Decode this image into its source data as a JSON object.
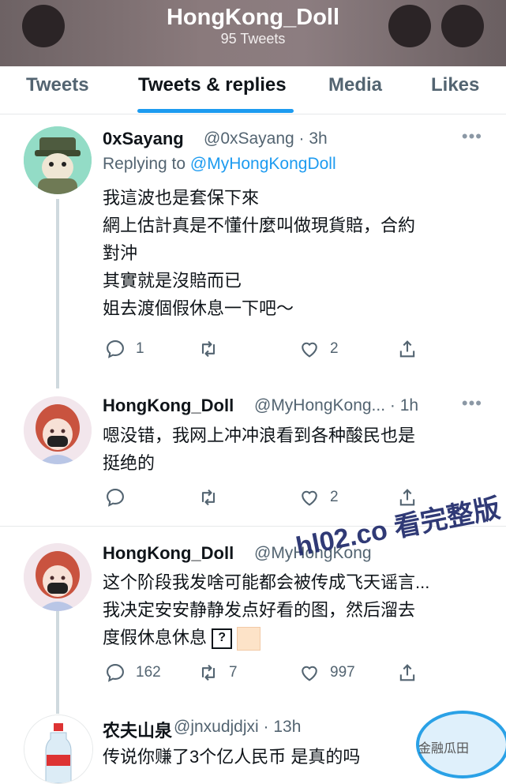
{
  "header": {
    "title": "HongKong_Doll",
    "subtitle": "95 Tweets"
  },
  "tabs": [
    {
      "label": "Tweets",
      "active": false
    },
    {
      "label": "Tweets & replies",
      "active": true
    },
    {
      "label": "Media",
      "active": false
    },
    {
      "label": "Likes",
      "active": false
    }
  ],
  "tweets": [
    {
      "name": "0xSayang",
      "meta": "@0xSayang · 3h",
      "reply_prefix": "Replying to",
      "reply_handle": "@MyHongKongDoll",
      "lines": [
        "我這波也是套保下來",
        "網上估計真是不懂什麼叫做現貨賠，合約",
        "對沖",
        "其實就是沒賠而已",
        "姐去渡個假休息一下吧～"
      ],
      "replies": "1",
      "retweets": "",
      "likes": "2"
    },
    {
      "name": "HongKong_Doll",
      "meta": "@MyHongKong... · 1h",
      "lines": [
        "嗯没错，我网上冲冲浪看到各种酸民也是",
        "挺绝的"
      ],
      "replies": "",
      "retweets": "",
      "likes": "2"
    },
    {
      "name": "HongKong_Doll",
      "meta": "@MyHongKong",
      "lines": [
        "这个阶段我发啥可能都会被传成飞天谣言...",
        "我决定安安静静发点好看的图，然后溜去",
        "度假休息休息"
      ],
      "qbox": "?",
      "replies": "162",
      "retweets": "7",
      "likes": "997"
    },
    {
      "name": "农夫山泉",
      "meta": "@jnxudjdjxi · 13h",
      "lines": [
        "传说你赚了3个亿人民币 是真的吗"
      ]
    }
  ],
  "watermark": {
    "text": "hl02.co 看完整版",
    "corner": "金融瓜田"
  },
  "colors": {
    "accent": "#1d9bf0",
    "secondary_text": "#536471",
    "divider": "#e6e9ea"
  }
}
